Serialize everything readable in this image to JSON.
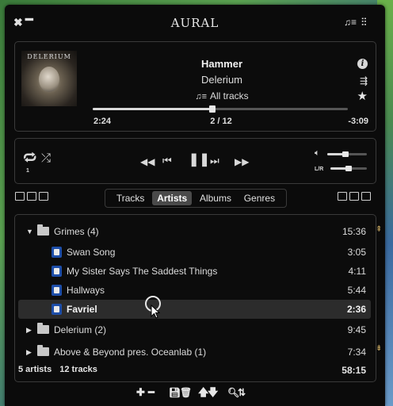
{
  "window": {
    "title": "AURAL",
    "close_icon": "close-icon",
    "minimize_icon": "minimize-icon",
    "playlist_icon": "playlist-icon",
    "settings_icon": "sliders-icon"
  },
  "now_playing": {
    "album_art_text": "DELERIUM",
    "title": "Hammer",
    "artist": "Delerium",
    "playlist": "All tracks",
    "elapsed": "2:24",
    "position": "2 / 12",
    "remaining": "-3:09",
    "progress": 0.47
  },
  "controls": {
    "repeat_count": "1",
    "balance_label": "L/R",
    "volume_level": 0.45,
    "balance_level": 0.5
  },
  "tabs": [
    {
      "label": "Tracks",
      "active": false
    },
    {
      "label": "Artists",
      "active": true
    },
    {
      "label": "Albums",
      "active": false
    },
    {
      "label": "Genres",
      "active": false
    }
  ],
  "list": {
    "rows": [
      {
        "type": "group",
        "expanded": true,
        "label": "Grimes (4)",
        "duration": "15:36"
      },
      {
        "type": "track",
        "label": "Swan Song",
        "duration": "3:05"
      },
      {
        "type": "track",
        "label": "My Sister Says The Saddest Things",
        "duration": "4:11"
      },
      {
        "type": "track",
        "label": "Hallways",
        "duration": "5:44"
      },
      {
        "type": "track",
        "label": "Favriel",
        "duration": "2:36",
        "selected": true
      },
      {
        "type": "group",
        "expanded": false,
        "label": "Delerium (2)",
        "duration": "9:45"
      },
      {
        "type": "group",
        "expanded": false,
        "label": "Above & Beyond pres. Oceanlab (1)",
        "duration": "7:34"
      }
    ],
    "summary_artists": "5 artists",
    "summary_tracks": "12 tracks",
    "summary_total": "58:15"
  }
}
